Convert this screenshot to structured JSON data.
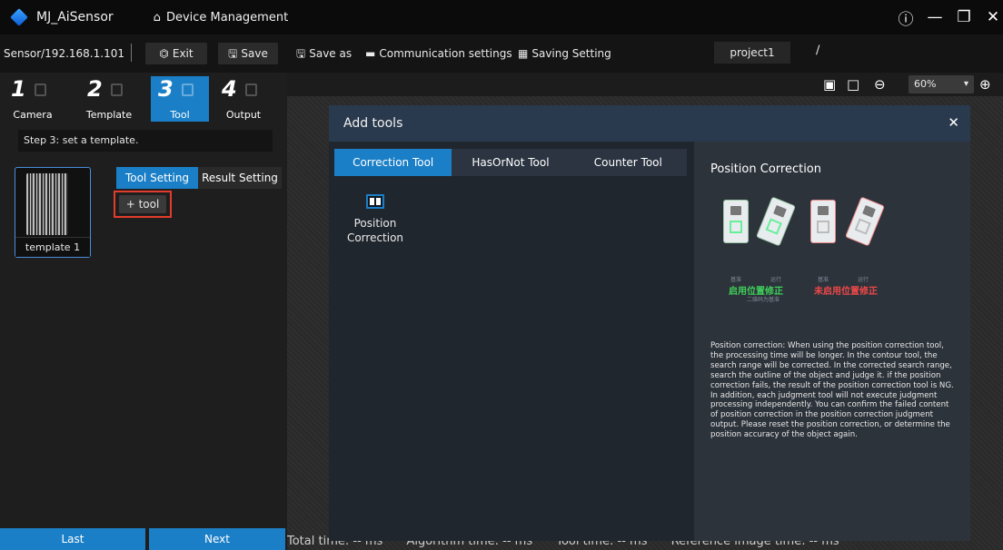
{
  "window": {
    "app_title": "MJ_AiSensor",
    "nav_label": "Device Management",
    "icons": {
      "logo": "app-logo-icon",
      "home": "home-icon",
      "info": "info-icon",
      "minimize": "minimize-icon",
      "maximize": "restore-icon",
      "close": "close-icon"
    }
  },
  "toolbar": {
    "sensor": "Sensor/192.168.1.101",
    "exit_label": "Exit",
    "save_label": "Save",
    "save_as_label": "Save as",
    "comm_label": "Communication settings",
    "saving_label": "Saving Setting",
    "project_name": "project1"
  },
  "steps": [
    {
      "num": "1",
      "label": "Camera",
      "active": false
    },
    {
      "num": "2",
      "label": "Template",
      "active": false
    },
    {
      "num": "3",
      "label": "Tool",
      "active": true
    },
    {
      "num": "4",
      "label": "Output",
      "active": false
    }
  ],
  "left_panel": {
    "step_hint": "Step 3: set a template.",
    "template_label": "template 1",
    "tab_tool_setting": "Tool Setting",
    "tab_result_setting": "Result Setting",
    "add_tool_label": "+ tool",
    "last_label": "Last",
    "next_label": "Next"
  },
  "canvas_toolbar": {
    "zoom": "60%"
  },
  "status": {
    "total": "Total time: -- ms",
    "algorithm": "Algorithm time: -- ms",
    "tool": "Tool time: -- ms",
    "reference": "Reference image time: -- ms"
  },
  "modal": {
    "title": "Add tools",
    "tabs": [
      "Correction Tool",
      "HasOrNot Tool",
      "Counter Tool"
    ],
    "active_tab": 0,
    "tool_item_label_1": "Position",
    "tool_item_label_2": "Correction",
    "desc_title": "Position Correction",
    "illus_ok": "启用位置修正",
    "illus_ng": "未启用位置修正",
    "illus_tiny_1": "基准",
    "illus_tiny_2": "运行",
    "illus_tiny_3": "基准",
    "illus_tiny_4": "运行",
    "illus_sub": "二维码为基准",
    "description": "Position correction: When using the position correction tool, the processing time will be longer. In the contour tool, the search range will be corrected. In the corrected search range, search the outline of the object and judge it. if the position correction fails, the result of the position correction tool is NG. In addition, each judgment tool will not execute judgment processing independently. You can confirm the failed content of position correction in the position correction judgment output. Please reset the position correction, or determine the position accuracy of the object again."
  },
  "colors": {
    "accent": "#1b7fc7",
    "highlight": "#e23c2c",
    "ok": "#3fd15a",
    "ng": "#f04848"
  }
}
